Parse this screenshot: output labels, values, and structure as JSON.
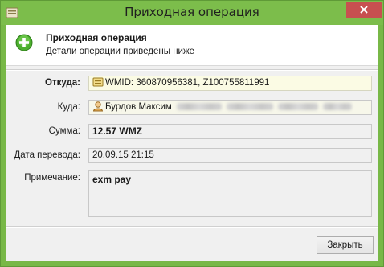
{
  "window": {
    "title": "Приходная операция",
    "accent": "#7cbd4b"
  },
  "header": {
    "title": "Приходная операция",
    "subtitle": "Детали операции приведены ниже",
    "icon": "plus-circle-icon"
  },
  "fields": {
    "from": {
      "label": "Откуда:",
      "value": "WMID: 360870956381, Z100755811991",
      "icon": "purse-icon"
    },
    "to": {
      "label": "Куда:",
      "value": "Бурдов Максим",
      "icon": "user-icon"
    },
    "amount": {
      "label": "Сумма:",
      "value": "12.57 WMZ"
    },
    "date": {
      "label": "Дата перевода:",
      "value": "20.09.15 21:15"
    },
    "note": {
      "label": "Примечание:",
      "value": "exm pay"
    }
  },
  "buttons": {
    "close_label": "Закрыть"
  }
}
